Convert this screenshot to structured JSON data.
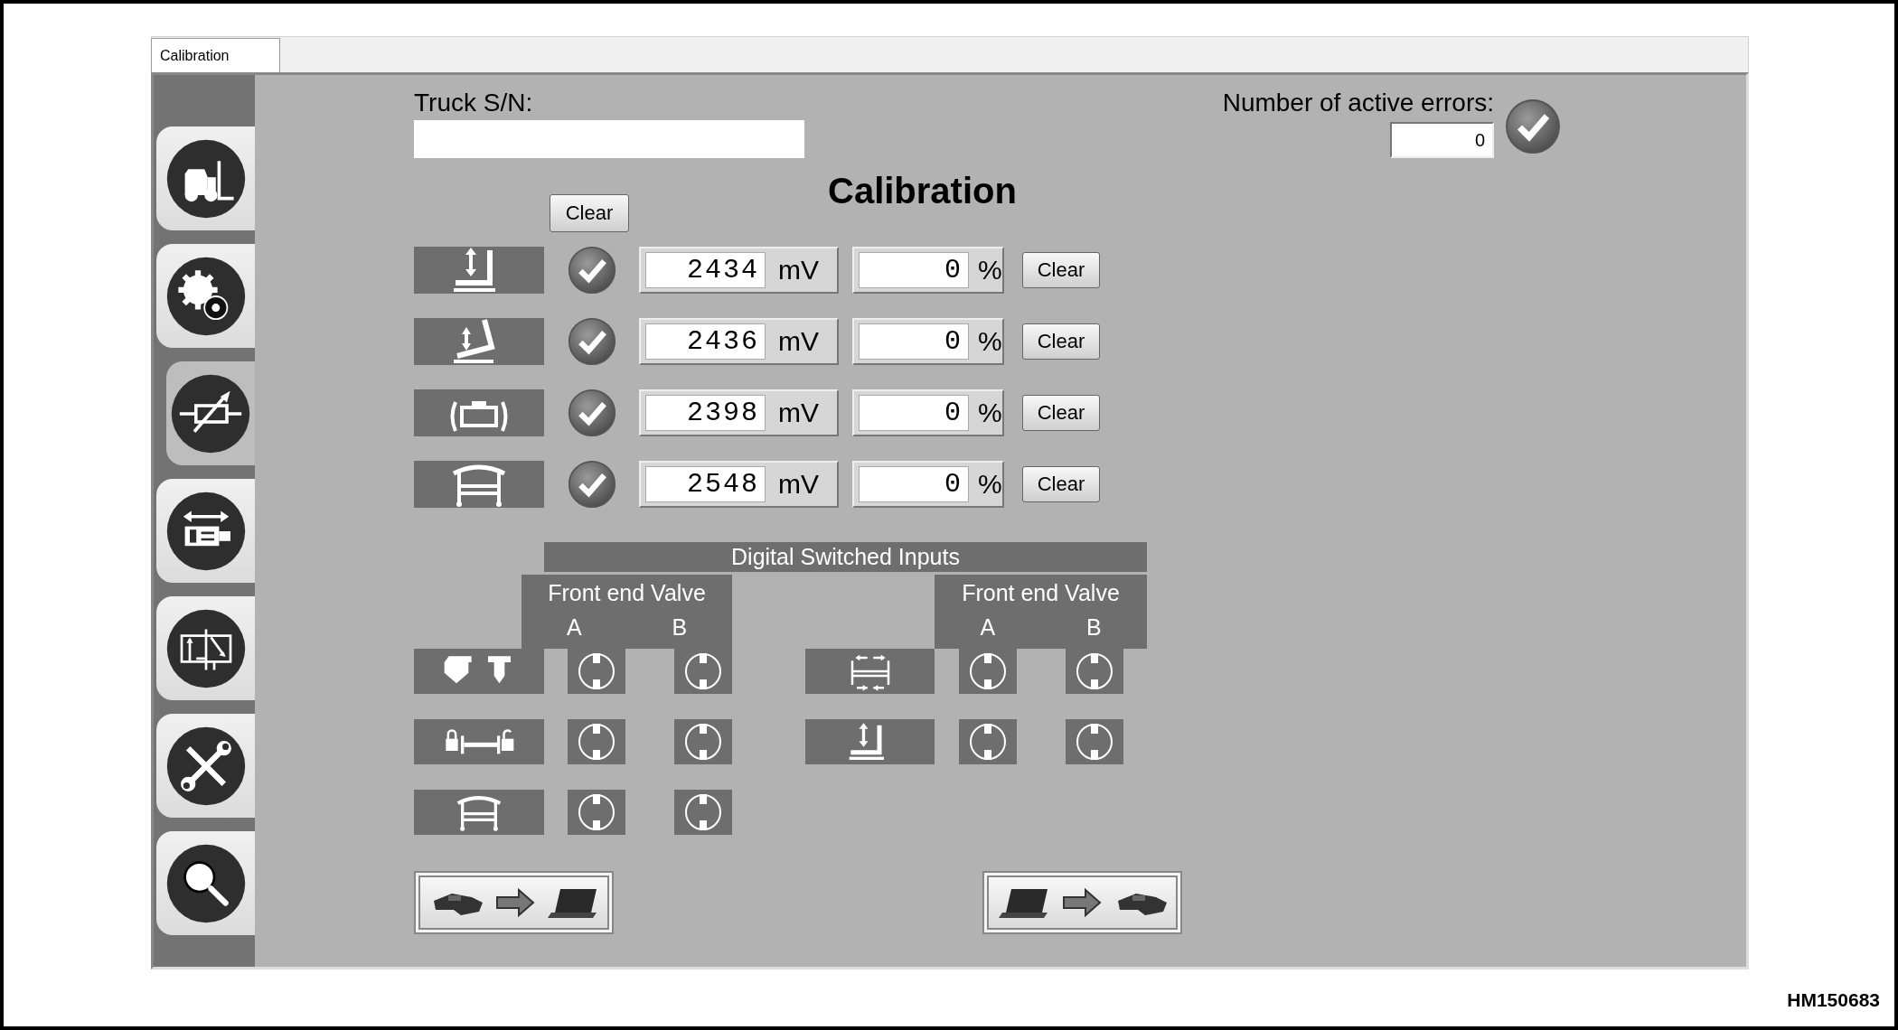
{
  "tabs": [
    {
      "label": "Calibration",
      "selected": true
    }
  ],
  "sidebar": {
    "items": [
      {
        "kind": "truck",
        "selected": false
      },
      {
        "kind": "gears",
        "selected": false
      },
      {
        "kind": "resistor",
        "selected": true
      },
      {
        "kind": "cylinder",
        "selected": false
      },
      {
        "kind": "valve",
        "selected": false
      },
      {
        "kind": "tools",
        "selected": false
      },
      {
        "kind": "search",
        "selected": false
      }
    ]
  },
  "truck_sn": {
    "label": "Truck S/N:"
  },
  "active_errors": {
    "label": "Number of active errors:",
    "value": "0",
    "ok": true
  },
  "title": "Calibration",
  "clear_all_button": "Clear",
  "sensors": [
    {
      "kind": "lift",
      "ok": true,
      "voltage": "2434",
      "voltage_unit": "mV",
      "percent": "0",
      "percent_unit": "%",
      "clear_button": "Clear"
    },
    {
      "kind": "tilt",
      "ok": true,
      "voltage": "2436",
      "voltage_unit": "mV",
      "percent": "0",
      "percent_unit": "%",
      "clear_button": "Clear"
    },
    {
      "kind": "sideshift",
      "ok": true,
      "voltage": "2398",
      "voltage_unit": "mV",
      "percent": "0",
      "percent_unit": "%",
      "clear_button": "Clear"
    },
    {
      "kind": "frame",
      "ok": true,
      "voltage": "2548",
      "voltage_unit": "mV",
      "percent": "0",
      "percent_unit": "%",
      "clear_button": "Clear"
    }
  ],
  "digital_inputs": {
    "title": "Digital Switched Inputs",
    "groups": [
      {
        "title": "Front end Valve",
        "columns": [
          "A",
          "B"
        ],
        "rows": [
          {
            "kind": "lower",
            "a_on": false,
            "b_on": false
          },
          {
            "kind": "lock",
            "a_on": false,
            "b_on": false
          },
          {
            "kind": "frame",
            "a_on": false,
            "b_on": false
          }
        ]
      },
      {
        "title": "Front end Valve",
        "columns": [
          "A",
          "B"
        ],
        "rows": [
          {
            "kind": "spread",
            "a_on": false,
            "b_on": false
          },
          {
            "kind": "lift",
            "a_on": false,
            "b_on": false
          }
        ]
      }
    ]
  },
  "transfer_buttons": [
    {
      "kind": "truck_to_laptop"
    },
    {
      "kind": "laptop_to_truck"
    }
  ],
  "figure_label": "HM150683"
}
